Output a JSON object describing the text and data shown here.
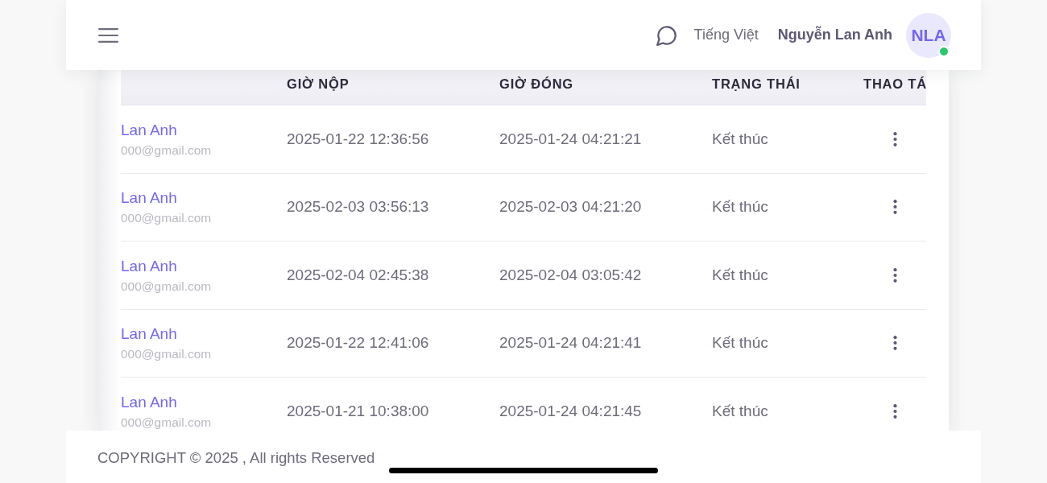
{
  "header": {
    "language": "Tiếng Việt",
    "user_name": "Nguyễn Lan Anh",
    "avatar": {
      "initials": "NLA",
      "online": true
    }
  },
  "table": {
    "columns": [
      "GIỜ NỘP",
      "GIỜ ĐÓNG",
      "TRẠNG THÁI",
      "THAO TÁ"
    ],
    "rows": [
      {
        "name": "Lan Anh",
        "email": "000@gmail.com",
        "submitted": "2025-01-22 12:36:56",
        "closed": "2025-01-24 04:21:21",
        "status": "Kết thúc"
      },
      {
        "name": "Lan Anh",
        "email": "000@gmail.com",
        "submitted": "2025-02-03 03:56:13",
        "closed": "2025-02-03 04:21:20",
        "status": "Kết thúc"
      },
      {
        "name": "Lan Anh",
        "email": "000@gmail.com",
        "submitted": "2025-02-04 02:45:38",
        "closed": "2025-02-04 03:05:42",
        "status": "Kết thúc"
      },
      {
        "name": "Lan Anh",
        "email": "000@gmail.com",
        "submitted": "2025-01-22 12:41:06",
        "closed": "2025-01-24 04:21:41",
        "status": "Kết thúc"
      },
      {
        "name": "Lan Anh",
        "email": "000@gmail.com",
        "submitted": "2025-01-21 10:38:00",
        "closed": "2025-01-24 04:21:45",
        "status": "Kết thúc"
      }
    ]
  },
  "footer": {
    "copyright": "COPYRIGHT © 2025 , All rights Reserved"
  }
}
